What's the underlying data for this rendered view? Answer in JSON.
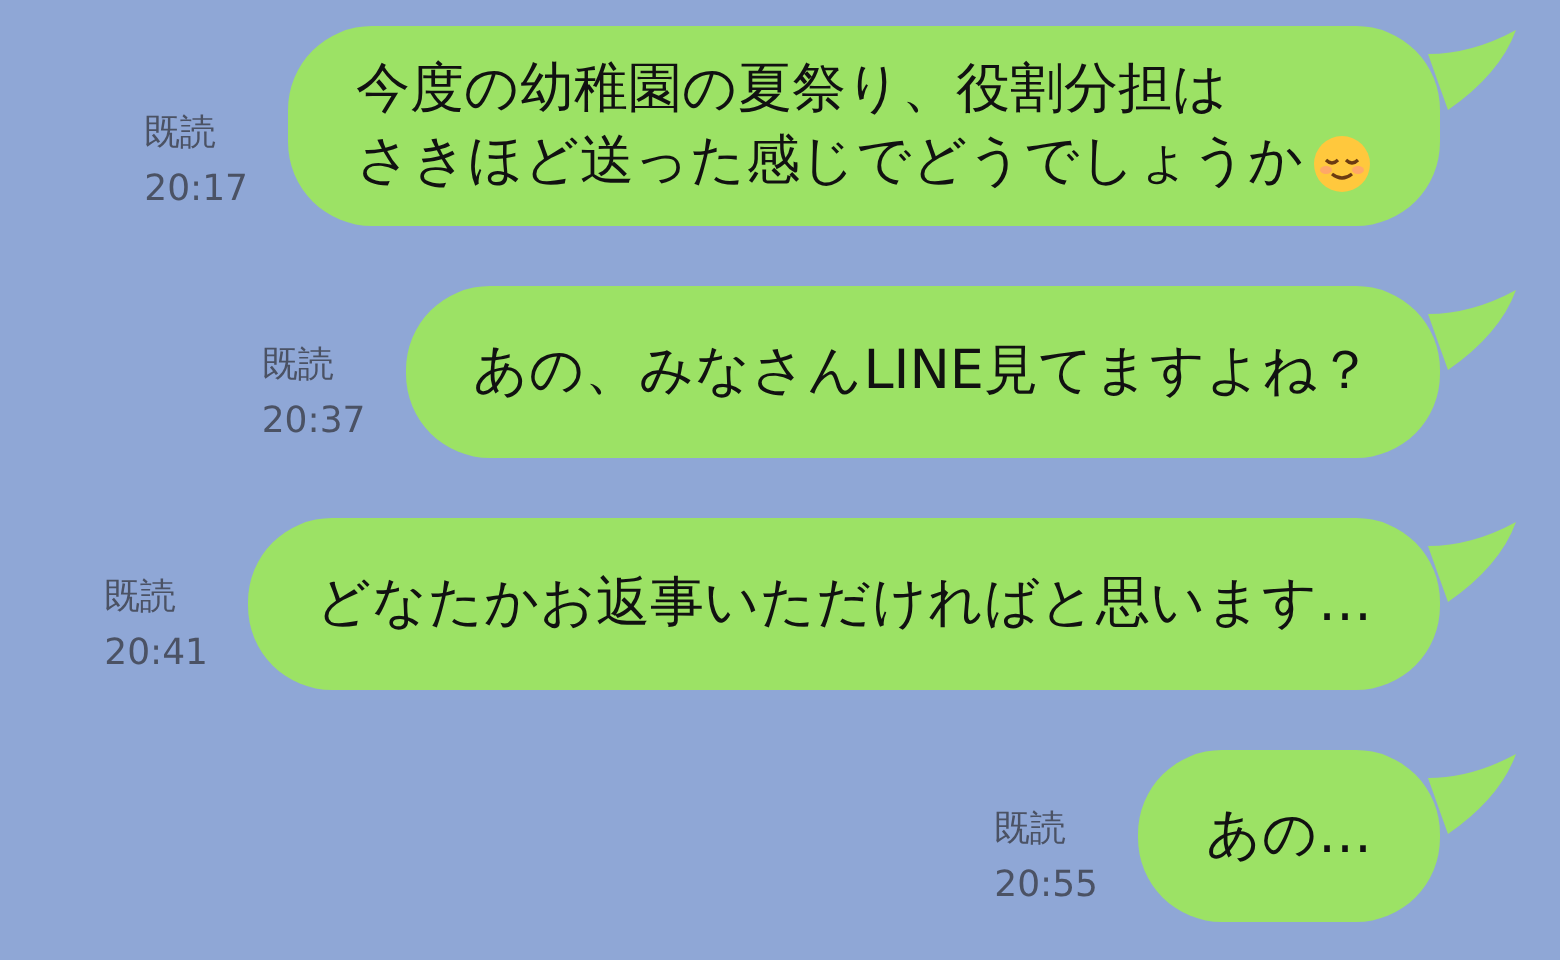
{
  "messages": [
    {
      "kind": "emoji",
      "lines": [
        "今度の幼稚園の夏祭り、役割分担は",
        "さきほど送った感じでどうでしょうか"
      ],
      "read": "既読",
      "time": "20:17"
    },
    {
      "kind": "plain",
      "lines": [
        "あの、みなさんLINE見てますよね？"
      ],
      "read": "既読",
      "time": "20:37"
    },
    {
      "kind": "plain",
      "lines": [
        "どなたかお返事いただければと思います…"
      ],
      "read": "既読",
      "time": "20:41"
    },
    {
      "kind": "plain",
      "lines": [
        "あの…"
      ],
      "read": "既読",
      "time": "20:55"
    }
  ]
}
